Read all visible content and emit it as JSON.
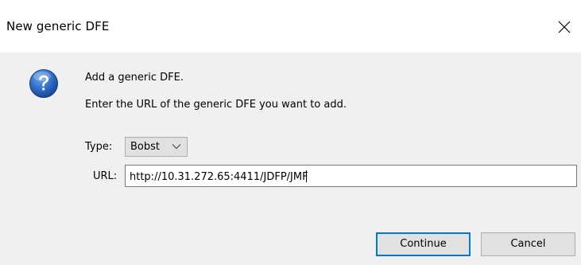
{
  "dialog": {
    "title": "New generic DFE",
    "close_icon": "close-icon",
    "message_icon": "question-icon"
  },
  "message": {
    "line1": "Add a generic DFE.",
    "line2": "Enter the URL of the generic DFE you want to add."
  },
  "form": {
    "type_label": "Type:",
    "type_value": "Bobst",
    "type_chevron_icon": "chevron-down-icon",
    "url_label": "URL:",
    "url_value": "http://10.31.272.65:4411/JDFP/JMF"
  },
  "buttons": {
    "continue_label": "Continue",
    "cancel_label": "Cancel"
  },
  "colors": {
    "accent": "#0078d7",
    "dialog_bg": "#f0f0f0",
    "titlebar_bg": "#ffffff",
    "button_bg": "#e1e1e1"
  }
}
